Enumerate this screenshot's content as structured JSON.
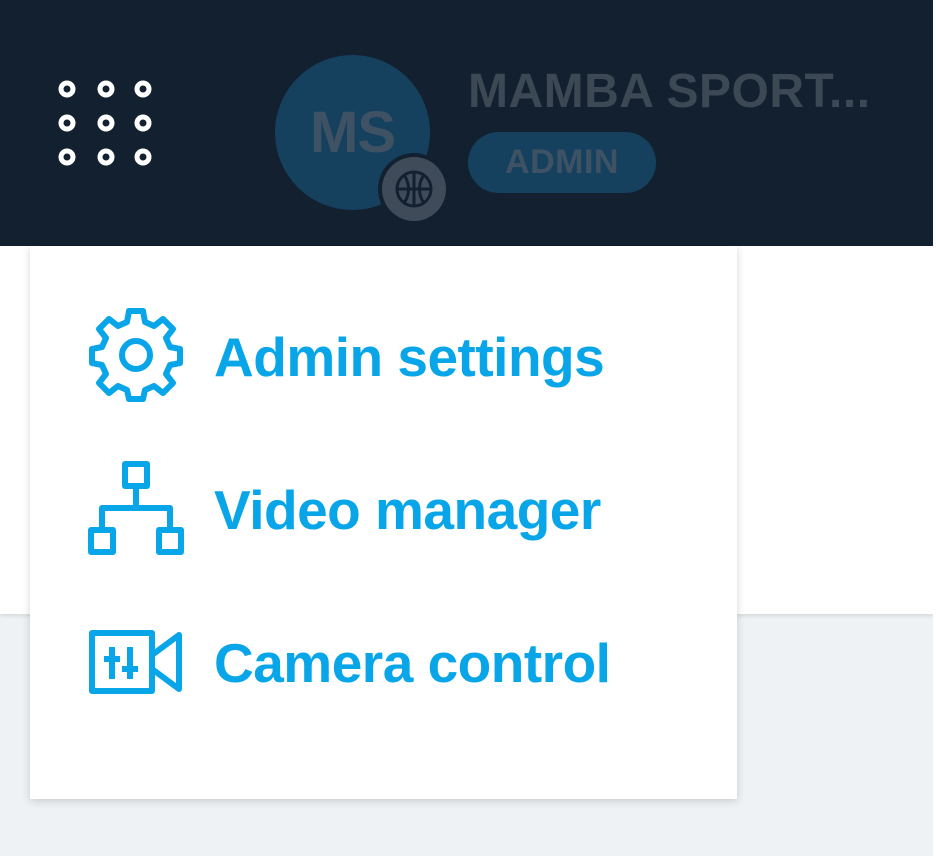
{
  "header": {
    "org_initials": "MS",
    "org_name": "MAMBA SPORT...",
    "role": "ADMIN",
    "sport_icon": "basketball-icon",
    "launcher_icon": "grid-dots-icon"
  },
  "menu": {
    "items": [
      {
        "label": "Admin settings",
        "icon": "gear-icon"
      },
      {
        "label": "Video manager",
        "icon": "sitemap-icon"
      },
      {
        "label": "Camera control",
        "icon": "camera-control-icon"
      }
    ]
  },
  "colors": {
    "topbar": "#13202f",
    "accent": "#08a6e8",
    "avatar": "#15415f",
    "background": "#eef2f4"
  }
}
